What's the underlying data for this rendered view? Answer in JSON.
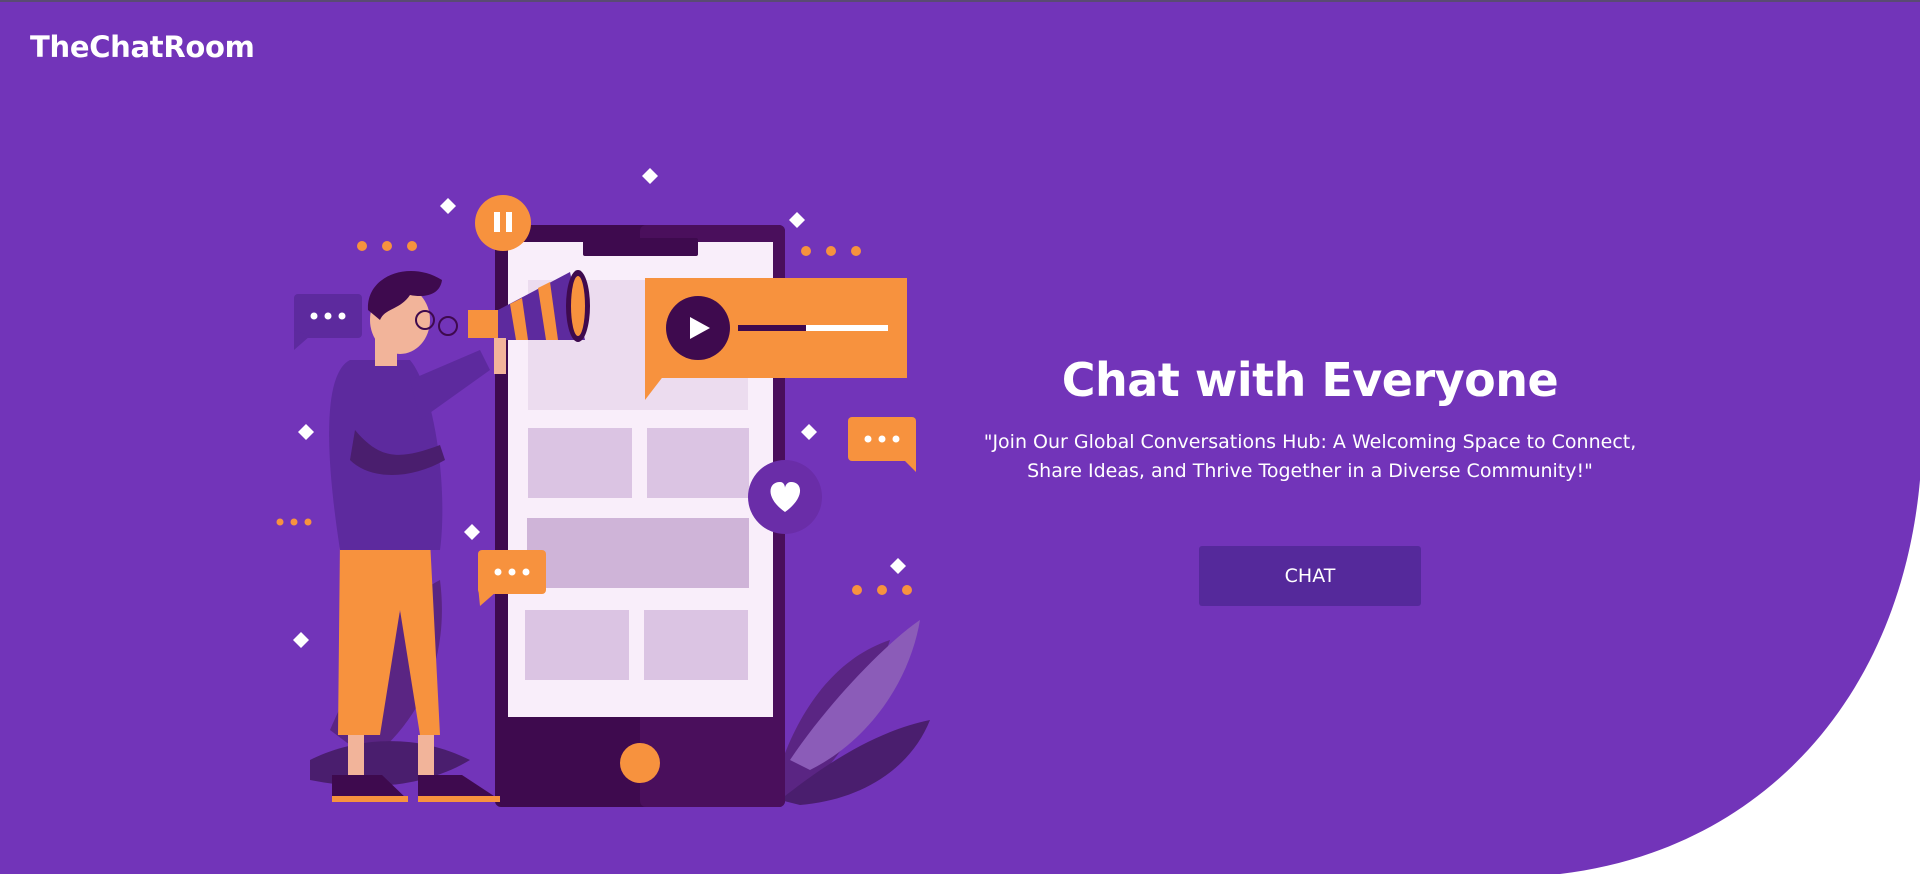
{
  "brand": {
    "name": "TheChatRoom"
  },
  "hero": {
    "headline": "Chat with Everyone",
    "tagline": "\"Join Our Global Conversations Hub: A Welcoming Space to Connect, Share Ideas, and Thrive Together in a Diverse Community!\"",
    "cta_label": "CHAT"
  },
  "illustration": {
    "subject": "person-with-megaphone-and-smartphone",
    "icons": [
      "pause-icon",
      "play-icon",
      "heart-icon",
      "chat-bubble-icon",
      "megaphone-icon",
      "sparkle-icon"
    ]
  },
  "colors": {
    "primary": "#7234b9",
    "button": "#55299b",
    "accent": "#f7923e",
    "dark": "#3e0a4e",
    "background": "#ffffff",
    "text": "#ffffff"
  }
}
